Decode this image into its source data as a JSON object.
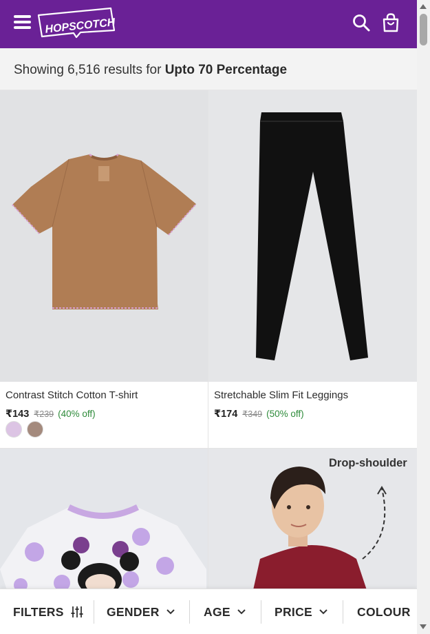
{
  "header": {
    "brand": "HOPSCOTCH",
    "menu_icon": "hamburger-menu-icon",
    "search_icon": "search-icon",
    "cart_icon": "shopping-bag-icon",
    "bg_color": "#6a2196"
  },
  "results": {
    "prefix": "Showing 6,516 results for ",
    "query": "Upto 70 Percentage"
  },
  "products": [
    {
      "name": "Contrast Stitch Cotton T-shirt",
      "price": "₹143",
      "mrp": "₹239",
      "discount": "(40% off)",
      "swatches": [
        "#dcc4e4",
        "#a48a7d"
      ]
    },
    {
      "name": "Stretchable Slim Fit Leggings",
      "price": "₹174",
      "mrp": "₹349",
      "discount": "(50% off)",
      "swatches": []
    },
    {
      "name": "",
      "image_label": ""
    },
    {
      "name": "",
      "image_label": "Drop-shoulder"
    }
  ],
  "filters": {
    "filters_label": "FILTERS",
    "gender_label": "GENDER",
    "age_label": "AGE",
    "price_label": "PRICE",
    "colour_label": "COLOUR"
  },
  "colors": {
    "discount_green": "#2e8b3a",
    "accent_purple": "#6a2196"
  }
}
